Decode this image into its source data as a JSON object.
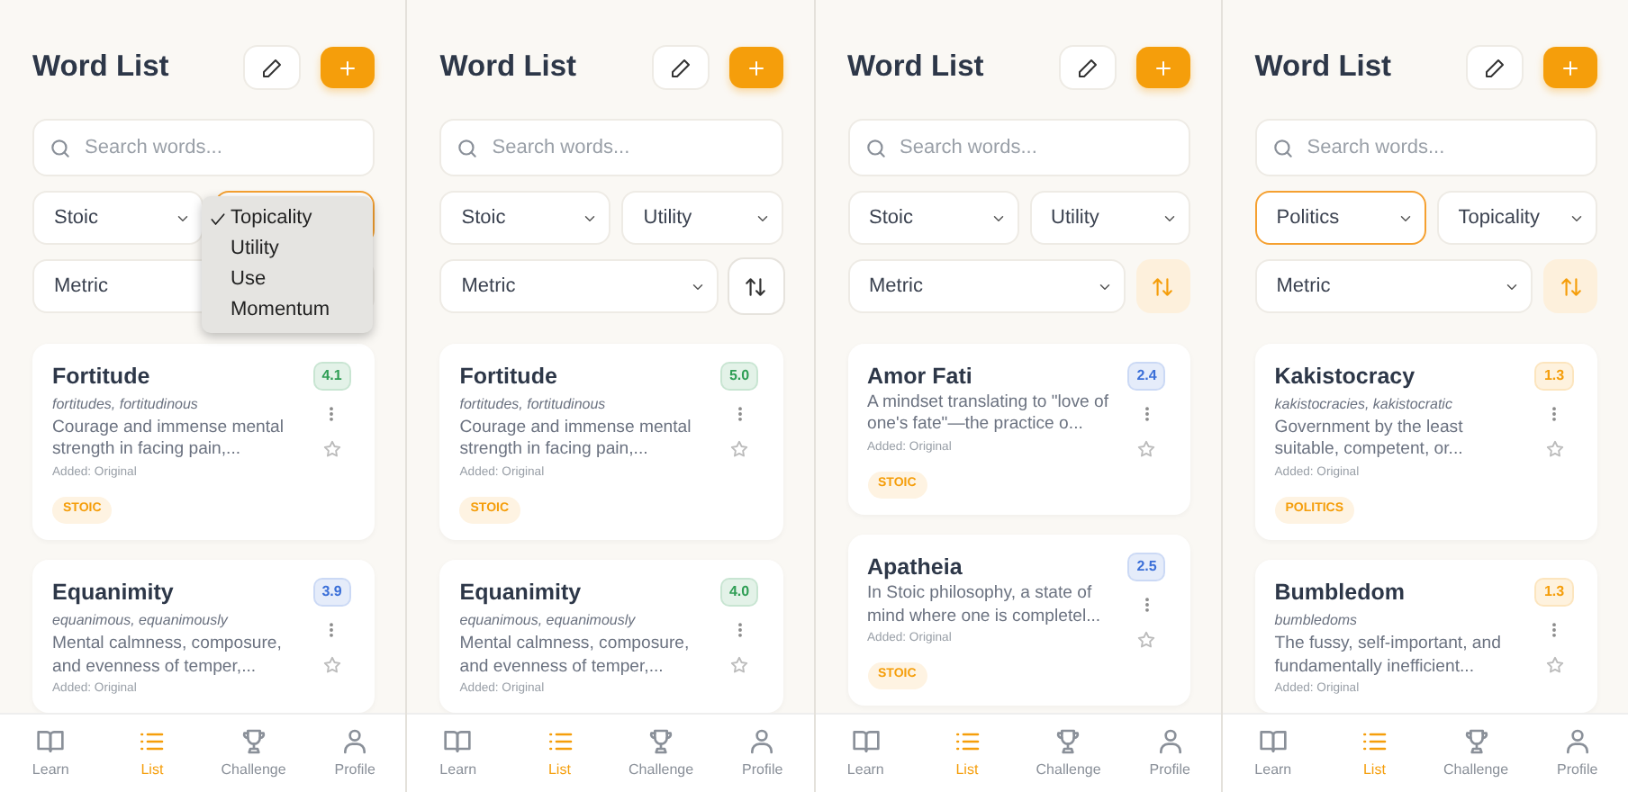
{
  "panels": [
    {
      "title": "Word List",
      "search": {
        "placeholder": "Search words..."
      },
      "filters": [
        {
          "value": "Stoic",
          "focused": false
        },
        {
          "focused": true
        }
      ],
      "metric": {
        "value": "Metric"
      },
      "dropdown": {
        "options": [
          {
            "label": "Topicality",
            "selected": true
          },
          {
            "label": "Utility",
            "selected": false
          },
          {
            "label": "Use",
            "selected": false
          },
          {
            "label": "Momentum",
            "selected": false
          }
        ]
      },
      "words": [
        {
          "word": "Fortitude",
          "forms": "fortitudes, fortitudinous",
          "definition": "Courage and immense mental strength in facing pain,...",
          "added": "Added: Original",
          "tag": "STOIC",
          "score": "4.1",
          "color": "#2f9e55"
        },
        {
          "word": "Equanimity",
          "forms": "equanimous, equanimously",
          "definition": "Mental calmness, composure, and evenness of temper,...",
          "added": "Added: Original",
          "score": "3.9",
          "color": "#3b6fd8"
        }
      ],
      "nav": [
        {
          "label": "Learn",
          "selected": false
        },
        {
          "label": "List",
          "selected": true
        },
        {
          "label": "Challenge",
          "selected": false
        },
        {
          "label": "Profile",
          "selected": false
        }
      ]
    },
    {
      "title": "Word List",
      "search": {
        "placeholder": "Search words..."
      },
      "filters": [
        {
          "value": "Stoic",
          "focused": false
        },
        {
          "value": "Utility",
          "focused": false
        }
      ],
      "metric": {
        "value": "Metric"
      },
      "sort": {
        "active": false
      },
      "words": [
        {
          "word": "Fortitude",
          "forms": "fortitudes, fortitudinous",
          "definition": "Courage and immense mental strength in facing pain,...",
          "added": "Added: Original",
          "tag": "STOIC",
          "score": "5.0",
          "color": "#2f9e55"
        },
        {
          "word": "Equanimity",
          "forms": "equanimous, equanimously",
          "definition": "Mental calmness, composure, and evenness of temper,...",
          "added": "Added: Original",
          "score": "4.0",
          "color": "#2f9e55"
        }
      ],
      "nav": [
        {
          "label": "Learn",
          "selected": false
        },
        {
          "label": "List",
          "selected": true
        },
        {
          "label": "Challenge",
          "selected": false
        },
        {
          "label": "Profile",
          "selected": false
        }
      ]
    },
    {
      "title": "Word List",
      "search": {
        "placeholder": "Search words..."
      },
      "filters": [
        {
          "value": "Stoic",
          "focused": false
        },
        {
          "value": "Utility",
          "focused": false
        }
      ],
      "metric": {
        "value": "Metric"
      },
      "sort": {
        "active": true
      },
      "words": [
        {
          "word": "Amor Fati",
          "definition": "A mindset translating to \"love of one's fate\"—the practice o...",
          "added": "Added: Original",
          "tag": "STOIC",
          "score": "2.4",
          "color": "#3b6fd8"
        },
        {
          "word": "Apatheia",
          "definition": "In Stoic philosophy, a state of mind where one is completel...",
          "added": "Added: Original",
          "tag": "STOIC",
          "score": "2.5",
          "color": "#3b6fd8"
        }
      ],
      "nav": [
        {
          "label": "Learn",
          "selected": false
        },
        {
          "label": "List",
          "selected": true
        },
        {
          "label": "Challenge",
          "selected": false
        },
        {
          "label": "Profile",
          "selected": false
        }
      ]
    },
    {
      "title": "Word List",
      "search": {
        "placeholder": "Search words..."
      },
      "filters": [
        {
          "value": "Politics",
          "focused": true
        },
        {
          "value": "Topicality",
          "focused": false
        }
      ],
      "metric": {
        "value": "Metric"
      },
      "sort": {
        "active": true
      },
      "words": [
        {
          "word": "Kakistocracy",
          "forms": "kakistocracies, kakistocratic",
          "definition": "Government by the least suitable, competent, or...",
          "added": "Added: Original",
          "tag": "POLITICS",
          "score": "1.3",
          "color": "#f59e0b"
        },
        {
          "word": "Bumbledom",
          "forms": "bumbledoms",
          "definition": "The fussy, self-important, and fundamentally inefficient...",
          "added": "Added: Original",
          "score": "1.3",
          "color": "#f59e0b"
        }
      ],
      "nav": [
        {
          "label": "Learn",
          "selected": false
        },
        {
          "label": "List",
          "selected": true
        },
        {
          "label": "Challenge",
          "selected": false
        },
        {
          "label": "Profile",
          "selected": false
        }
      ]
    }
  ]
}
